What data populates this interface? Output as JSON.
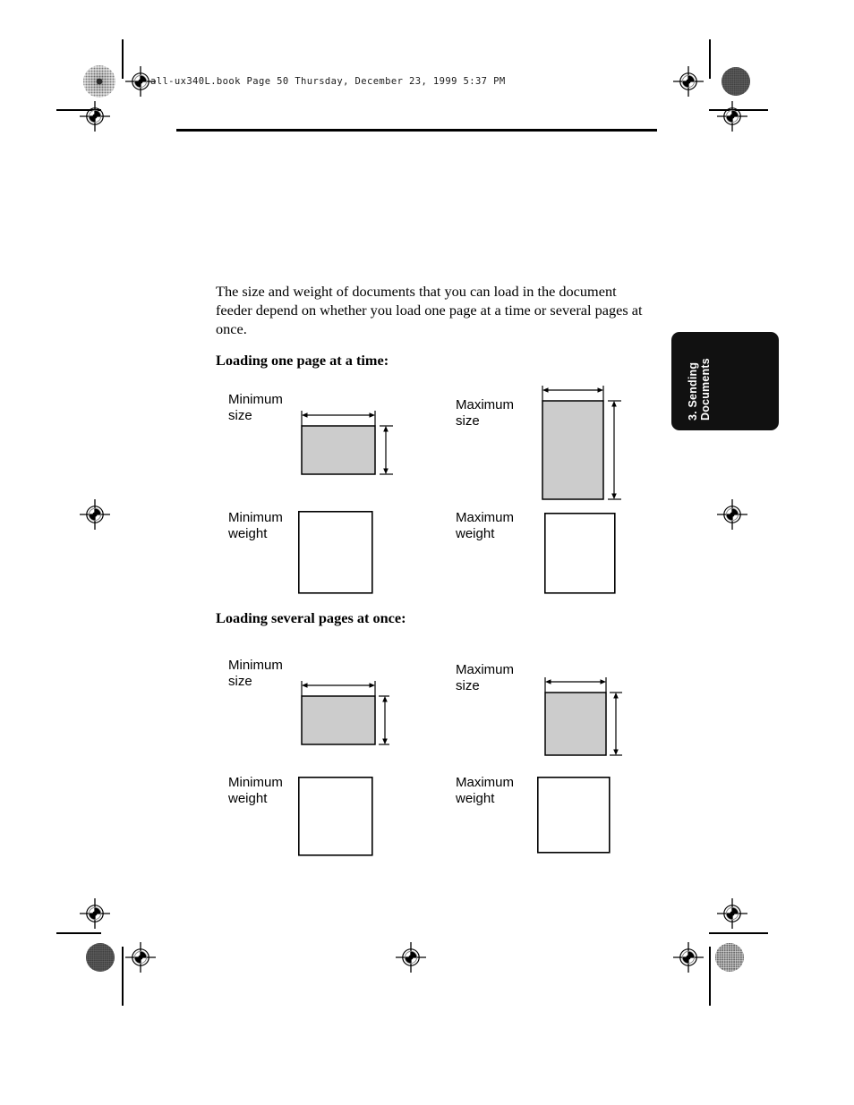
{
  "document": {
    "header_line": "all-ux340L.book  Page 50  Thursday, December 23, 1999  5:37 PM",
    "page_number": "50",
    "paragraph": "The size and weight of documents that you can load in the document feeder depend on whether you load one page at a time or several pages at once.",
    "sections": [
      {
        "heading": "Loading one page at a time:",
        "items": [
          {
            "label": "Minimum\nsize",
            "kind": "size-figure",
            "orientation": "landscape"
          },
          {
            "label": "Maximum\nsize",
            "kind": "size-figure",
            "orientation": "portrait"
          },
          {
            "label": "Minimum\nweight",
            "kind": "weight-figure",
            "orientation": "square"
          },
          {
            "label": "Maximum\nweight",
            "kind": "weight-figure",
            "orientation": "square"
          }
        ]
      },
      {
        "heading": "Loading several pages at once:",
        "items": [
          {
            "label": "Minimum\nsize",
            "kind": "size-figure",
            "orientation": "landscape"
          },
          {
            "label": "Maximum\nsize",
            "kind": "size-figure",
            "orientation": "portrait"
          },
          {
            "label": "Minimum\nweight",
            "kind": "weight-figure",
            "orientation": "square"
          },
          {
            "label": "Maximum\nweight",
            "kind": "weight-figure",
            "orientation": "square"
          }
        ]
      }
    ],
    "thumb_tab": {
      "line1": "3. Sending",
      "line2": "Documents",
      "full": "3. Sending\nDocuments"
    }
  },
  "colors": {
    "figure_fill": "#cccccc",
    "figure_stroke": "#000000",
    "tab_background": "#111111",
    "tab_text": "#ffffff",
    "page_background": "#ffffff",
    "text": "#000000"
  },
  "print_marks": {
    "registration_target": "registration-crosshair-mark",
    "halftone_target": "halftone-density-mark",
    "crop_rule": "crop-trim-rule"
  }
}
